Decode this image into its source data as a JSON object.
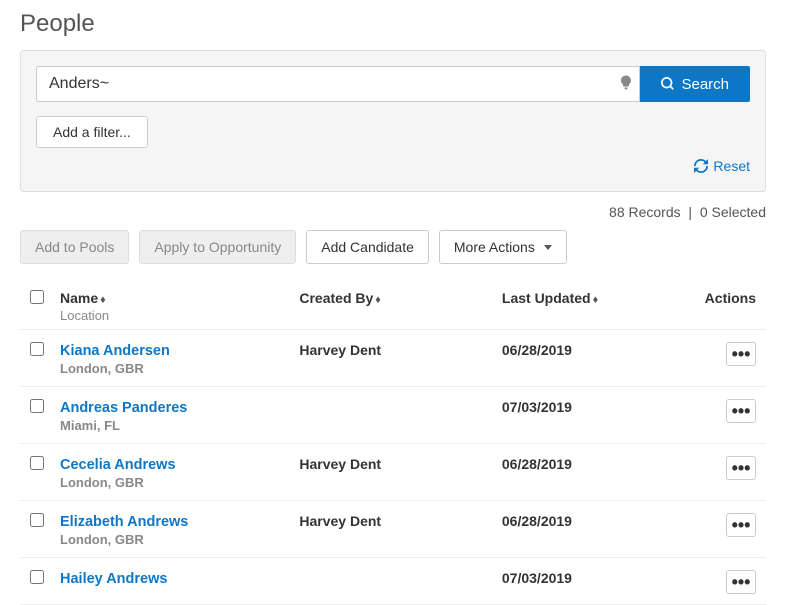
{
  "page_title": "People",
  "search": {
    "value": "Anders~",
    "button_label": "Search"
  },
  "add_filter_label": "Add a filter...",
  "reset_label": "Reset",
  "records_count": "88 Records",
  "selected_count": "0 Selected",
  "toolbar": {
    "add_to_pools": "Add to Pools",
    "apply_to_opportunity": "Apply to Opportunity",
    "add_candidate": "Add Candidate",
    "more_actions": "More Actions"
  },
  "headers": {
    "name": "Name",
    "name_sub": "Location",
    "created_by": "Created By",
    "last_updated": "Last Updated",
    "actions": "Actions"
  },
  "rows": [
    {
      "name": "Kiana Andersen",
      "location": "London, GBR",
      "created_by": "Harvey Dent",
      "last_updated": "06/28/2019"
    },
    {
      "name": "Andreas Panderes",
      "location": "Miami, FL",
      "created_by": "",
      "last_updated": "07/03/2019"
    },
    {
      "name": "Cecelia Andrews",
      "location": "London, GBR",
      "created_by": "Harvey Dent",
      "last_updated": "06/28/2019"
    },
    {
      "name": "Elizabeth Andrews",
      "location": "London, GBR",
      "created_by": "Harvey Dent",
      "last_updated": "06/28/2019"
    },
    {
      "name": "Hailey Andrews",
      "location": "",
      "created_by": "",
      "last_updated": "07/03/2019"
    }
  ]
}
